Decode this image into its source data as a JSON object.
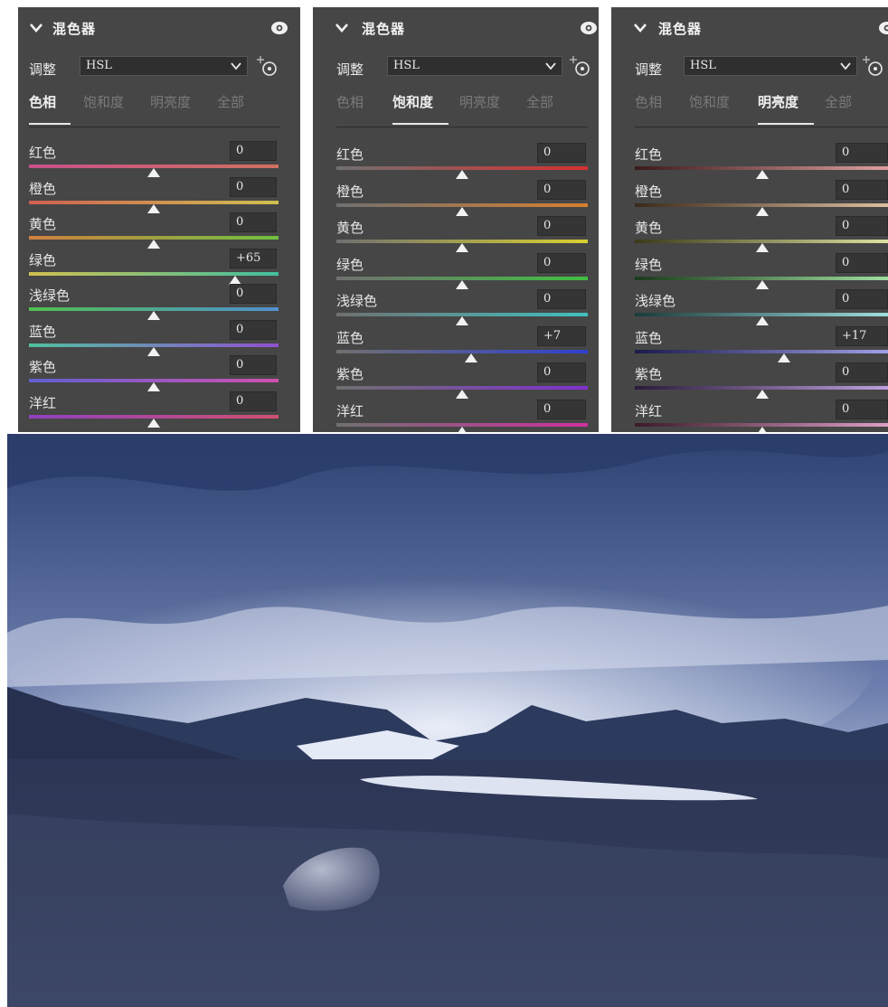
{
  "panels": [
    {
      "title": "混色器",
      "adjust_label": "调整",
      "mode": "HSL",
      "tabs": [
        "色相",
        "饱和度",
        "明亮度",
        "全部"
      ],
      "active_tab": 0,
      "rows": [
        {
          "label": "红色",
          "value": "0",
          "slider": 0.5
        },
        {
          "label": "橙色",
          "value": "0",
          "slider": 0.5
        },
        {
          "label": "黄色",
          "value": "0",
          "slider": 0.5
        },
        {
          "label": "绿色",
          "value": "+65",
          "slider": 0.825
        },
        {
          "label": "浅绿色",
          "value": "0",
          "slider": 0.5
        },
        {
          "label": "蓝色",
          "value": "0",
          "slider": 0.5
        },
        {
          "label": "紫色",
          "value": "0",
          "slider": 0.5
        },
        {
          "label": "洋红",
          "value": "0",
          "slider": 0.5
        }
      ]
    },
    {
      "title": "混色器",
      "adjust_label": "调整",
      "mode": "HSL",
      "tabs": [
        "色相",
        "饱和度",
        "明亮度",
        "全部"
      ],
      "active_tab": 1,
      "rows": [
        {
          "label": "红色",
          "value": "0",
          "slider": 0.5
        },
        {
          "label": "橙色",
          "value": "0",
          "slider": 0.5
        },
        {
          "label": "黄色",
          "value": "0",
          "slider": 0.5
        },
        {
          "label": "绿色",
          "value": "0",
          "slider": 0.5
        },
        {
          "label": "浅绿色",
          "value": "0",
          "slider": 0.5
        },
        {
          "label": "蓝色",
          "value": "+7",
          "slider": 0.535
        },
        {
          "label": "紫色",
          "value": "0",
          "slider": 0.5
        },
        {
          "label": "洋红",
          "value": "0",
          "slider": 0.5
        }
      ]
    },
    {
      "title": "混色器",
      "adjust_label": "调整",
      "mode": "HSL",
      "tabs": [
        "色相",
        "饱和度",
        "明亮度",
        "全部"
      ],
      "active_tab": 2,
      "rows": [
        {
          "label": "红色",
          "value": "0",
          "slider": 0.5
        },
        {
          "label": "橙色",
          "value": "0",
          "slider": 0.5
        },
        {
          "label": "黄色",
          "value": "0",
          "slider": 0.5
        },
        {
          "label": "绿色",
          "value": "0",
          "slider": 0.5
        },
        {
          "label": "浅绿色",
          "value": "0",
          "slider": 0.5
        },
        {
          "label": "蓝色",
          "value": "+17",
          "slider": 0.585
        },
        {
          "label": "紫色",
          "value": "0",
          "slider": 0.5
        },
        {
          "label": "洋红",
          "value": "0",
          "slider": 0.5
        }
      ]
    }
  ],
  "slider_gradients": {
    "hue": [
      [
        "#c8508a",
        "#d07060"
      ],
      [
        "#d06050",
        "#d0c050"
      ],
      [
        "#d08040",
        "#70c040"
      ],
      [
        "#d0c050",
        "#40c0a0"
      ],
      [
        "#50c050",
        "#5090d0"
      ],
      [
        "#50c0a0",
        "#9050d0"
      ],
      [
        "#6060d0",
        "#d050b0"
      ],
      [
        "#9040c0",
        "#d05070"
      ]
    ],
    "saturation": [
      [
        "#707070",
        "#d83030"
      ],
      [
        "#707070",
        "#d88030"
      ],
      [
        "#707070",
        "#d8d030"
      ],
      [
        "#707070",
        "#40c040"
      ],
      [
        "#707070",
        "#40c0c0"
      ],
      [
        "#707070",
        "#3040d0"
      ],
      [
        "#707070",
        "#8030d0"
      ],
      [
        "#707070",
        "#d030a0"
      ]
    ],
    "luminance": [
      [
        "#3a1a1a",
        "#e0a0a0"
      ],
      [
        "#3a2a1a",
        "#e0c0a0"
      ],
      [
        "#3a3a1a",
        "#e0e0a0"
      ],
      [
        "#1a3a1a",
        "#a0e0a0"
      ],
      [
        "#1a3a3a",
        "#a0e0e0"
      ],
      [
        "#1a1a4a",
        "#a0a0e8"
      ],
      [
        "#2a1a3a",
        "#c0a0e0"
      ],
      [
        "#3a1a2a",
        "#e0a0c8"
      ]
    ]
  },
  "photo_colors": {
    "sky_dark": "#2a3f6e",
    "cloud": "#c9d2e8",
    "mountain": "#2c3a5c",
    "glacier": "#e6ecf6",
    "ground": "#2a3250",
    "rock": "#8890a8"
  }
}
